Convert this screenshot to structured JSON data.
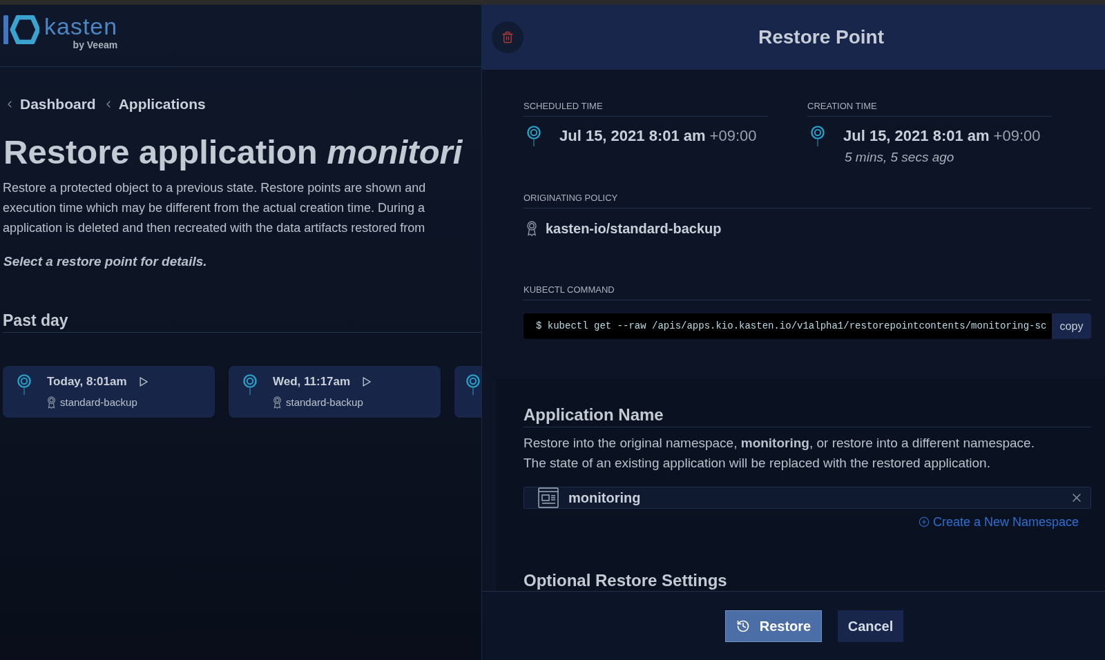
{
  "logo": {
    "name": "kasten",
    "tagline": "by Veeam"
  },
  "breadcrumbs": [
    {
      "label": "Dashboard"
    },
    {
      "label": "Applications"
    }
  ],
  "page": {
    "title": "Restore application *monitori*",
    "description_lines": [
      "Restore a protected object to a previous state. Restore points are shown and",
      "execution time which may be different from the actual creation time. During a",
      "application is deleted and then recreated with the data artifacts restored from"
    ],
    "hint": "Select a restore point for details."
  },
  "restore_points": {
    "group": "Past day",
    "cards": [
      {
        "kind": "full",
        "time": "Today, 8:01am",
        "policy": "standard-backup"
      },
      {
        "kind": "full",
        "time": "Wed, 11:17am",
        "policy": "standard-backup"
      },
      {
        "kind": "partial"
      }
    ]
  },
  "panel": {
    "title": "Restore Point",
    "scheduled": {
      "label": "SCHEDULED TIME",
      "time": "Jul 15, 2021 8:01 am",
      "offset": "+09:00"
    },
    "created": {
      "label": "CREATION TIME",
      "time": "Jul 15, 2021 8:01 am",
      "offset": "+09:00",
      "ago": "5 mins, 5 secs ago"
    },
    "policy": {
      "label": "ORIGINATING POLICY",
      "name": "kasten-io/standard-backup"
    },
    "kubectl": {
      "label": "KUBECTL COMMAND",
      "command": "$ kubectl get --raw /apis/apps.kio.kasten.io/v1alpha1/restorepointcontents/monitoring-sc",
      "copy": "copy"
    }
  },
  "application_name": {
    "heading": "Application Name",
    "description": "Restore into the original namespace, **monitoring**, or restore into a different namespace. The state of an existing application will be replaced with the restored application.",
    "namespace": "monitoring",
    "create_link": "Create a New Namespace"
  },
  "optional_heading": "Optional Restore Settings",
  "buttons": [
    {
      "kind": "primary",
      "label": "Restore"
    },
    {
      "kind": "secondary",
      "label": "Cancel"
    }
  ]
}
